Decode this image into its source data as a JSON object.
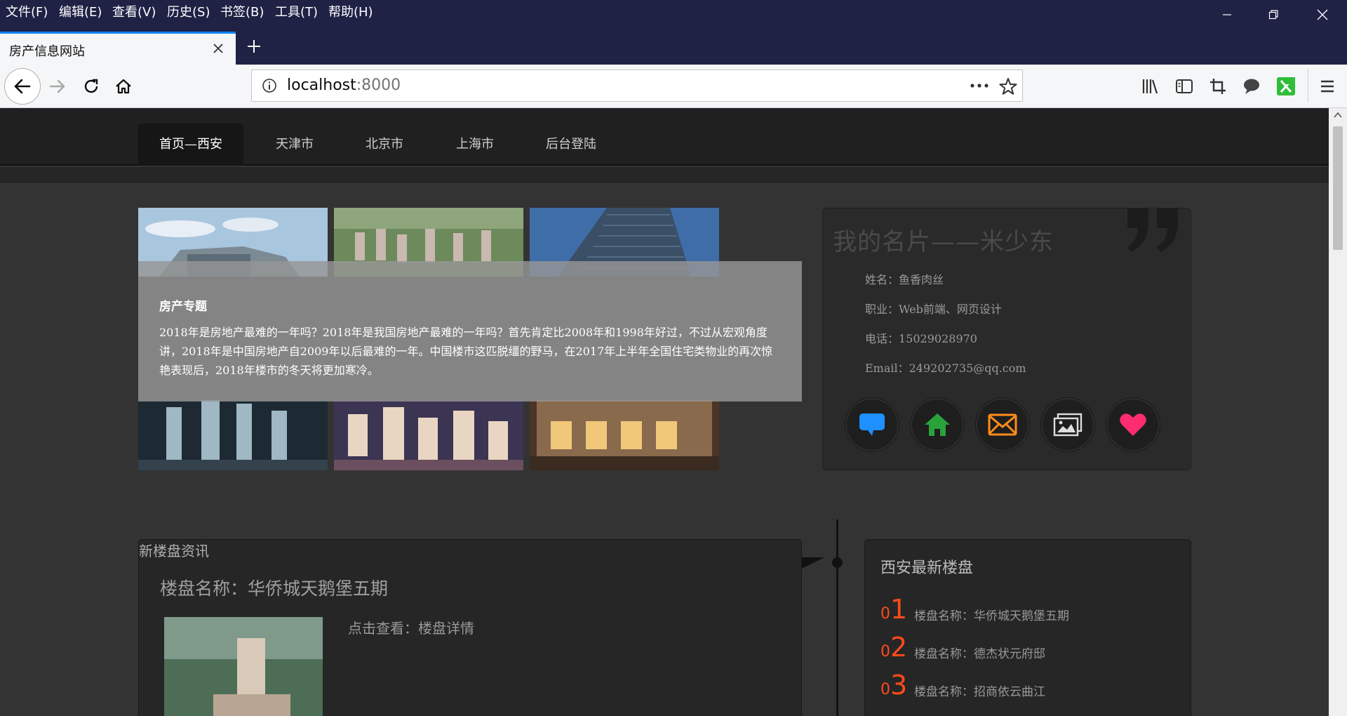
{
  "menubar": {
    "items": [
      "文件(F)",
      "编辑(E)",
      "查看(V)",
      "历史(S)",
      "书签(B)",
      "工具(T)",
      "帮助(H)"
    ]
  },
  "tab": {
    "title": "房产信息网站"
  },
  "urlbar": {
    "host": "localhost",
    "port": ":8000"
  },
  "site_nav": {
    "items": [
      "首页—西安",
      "天津市",
      "北京市",
      "上海市",
      "后台登陆"
    ]
  },
  "overlay": {
    "title": "房产专题",
    "text": "2018年是房地产最难的一年吗？2018年是我国房地产最难的一年吗？首先肯定比2008年和1998年好过，不过从宏观角度讲，2018年是中国房地产自2009年以后最难的一年。中国楼市这匹脱缰的野马，在2017年上半年全国住宅类物业的再次惊艳表现后，2018年楼市的冬天将更加寒冷。"
  },
  "card": {
    "title": "我的名片——米少东",
    "name": "姓名：鱼香肉丝",
    "job": "职业：Web前端、网页设计",
    "phone": "电话：15029028970",
    "email": "Email：249202735@qq.com",
    "social_icons": [
      "chat-icon",
      "home-icon",
      "mail-icon",
      "gallery-icon",
      "heart-icon"
    ],
    "social_colors": [
      "#1e90ff",
      "#2aa23a",
      "#ff8c1a",
      "#dddddd",
      "#ff2d6f"
    ]
  },
  "news": {
    "label": "新楼盘资讯",
    "name": "楼盘名称：华侨城天鹅堡五期",
    "link": "点击查看：楼盘详情"
  },
  "latest": {
    "title": "西安最新楼盘",
    "items": [
      {
        "num_prefix": "0",
        "num": "1",
        "text": "楼盘名称：华侨城天鹅堡五期"
      },
      {
        "num_prefix": "0",
        "num": "2",
        "text": "楼盘名称：德杰状元府邸"
      },
      {
        "num_prefix": "0",
        "num": "3",
        "text": "楼盘名称：招商依云曲江"
      }
    ]
  },
  "colors": {
    "browser_dark": "#1f2145",
    "accent_blue": "#0a84ff",
    "page_bg": "#333333",
    "latest_number": "#ff4a1a"
  }
}
